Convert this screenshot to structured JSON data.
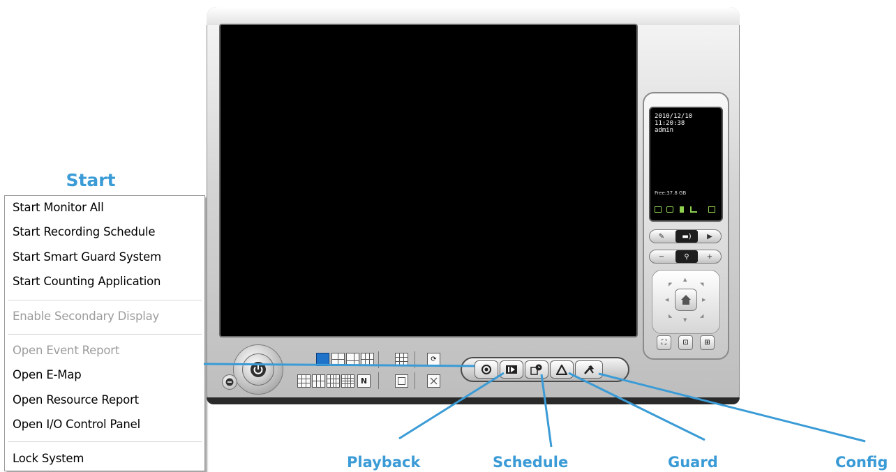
{
  "start_menu": {
    "heading": "Start",
    "items": [
      {
        "label": "Start Monitor All",
        "enabled": true
      },
      {
        "label": "Start Recording Schedule",
        "enabled": true
      },
      {
        "label": "Start Smart Guard System",
        "enabled": true
      },
      {
        "label": "Start Counting Application",
        "enabled": true
      },
      {
        "label": "Enable Secondary Display",
        "enabled": false
      },
      {
        "label": "Open Event Report",
        "enabled": false
      },
      {
        "label": "Open E-Map",
        "enabled": true
      },
      {
        "label": "Open Resource Report",
        "enabled": true
      },
      {
        "label": "Open I/O Control Panel",
        "enabled": true
      },
      {
        "label": "Lock System",
        "enabled": true
      }
    ]
  },
  "info_panel": {
    "date": "2010/12/10",
    "time": "11:20:38",
    "user": "admin",
    "free_space": "Free:37.8 GB"
  },
  "toolbar": {
    "buttons": [
      "start-icon",
      "playback-icon",
      "schedule-icon",
      "guard-icon",
      "config-icon"
    ]
  },
  "callouts": {
    "playback": "Playback",
    "schedule": "Schedule",
    "guard": "Guard",
    "config": "Config"
  },
  "colors": {
    "callout_blue": "#3a9bd6",
    "active_layout_blue": "#1f73c9",
    "status_icon_green": "#8fd14f"
  }
}
